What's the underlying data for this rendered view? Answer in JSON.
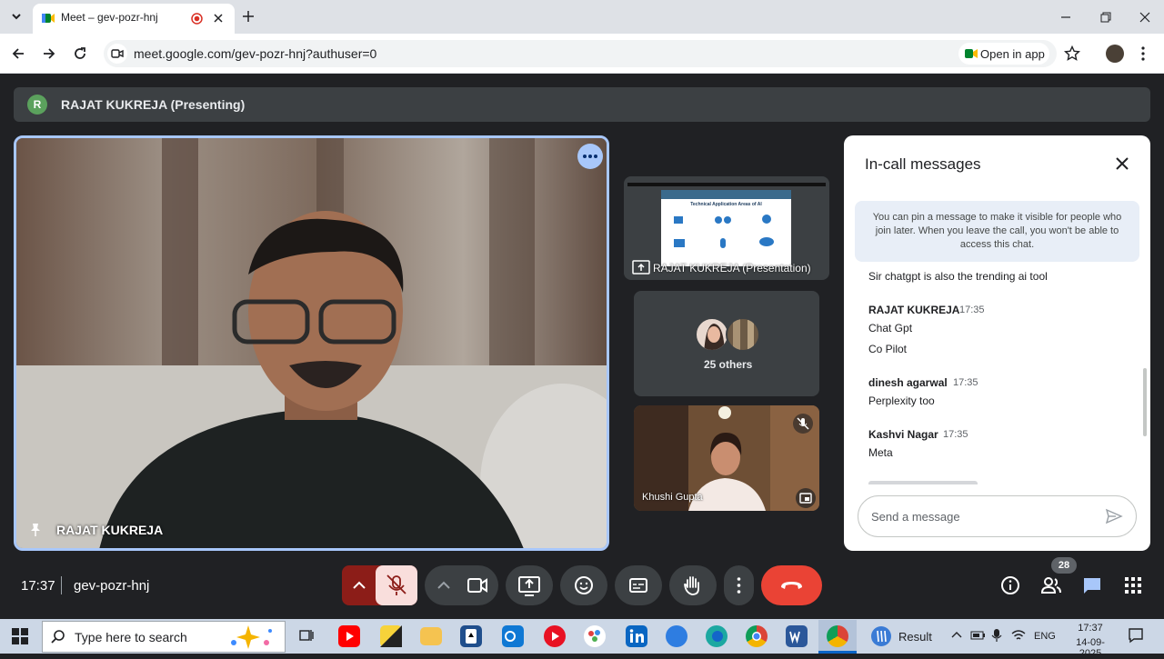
{
  "browser": {
    "tab_title": "Meet – gev-pozr-hnj",
    "url": "meet.google.com/gev-pozr-hnj?authuser=0",
    "open_in_app_label": "Open in app"
  },
  "meet": {
    "presenting_banner": {
      "avatar_letter": "R",
      "label": "RAJAT KUKREJA (Presenting)"
    },
    "main_tile": {
      "name": "RAJAT KUKREJA"
    },
    "side_tiles": {
      "screen_share_label": "RAJAT KUKREJA (Presentation)",
      "slide_title": "Technical Application Areas of AI",
      "others_label": "25 others",
      "participant_name": "Khushi Gupta"
    },
    "chat": {
      "title": "In-call messages",
      "info": "You can pin a message to make it visible for people who join later. When you leave the call, you won't be able to access this chat.",
      "messages_top": "Sir chatgpt is also the trending ai tool",
      "groups": [
        {
          "sender": "RAJAT KUKREJA",
          "time": "17:35",
          "lines": [
            "Chat Gpt",
            "Co Pilot"
          ]
        },
        {
          "sender": "dinesh agarwal",
          "time": "17:35",
          "lines": [
            "Perplexity too"
          ]
        },
        {
          "sender": "Kashvi Nagar",
          "time": "17:35",
          "lines": [
            "Meta"
          ]
        }
      ],
      "send_placeholder": "Send a message"
    },
    "bottom_bar": {
      "clock": "17:37",
      "meeting_code": "gev-pozr-hnj",
      "people_count": "28"
    }
  },
  "taskbar": {
    "search_placeholder": "Type here to search",
    "result_label": "Result",
    "language": "ENG",
    "time": "17:37",
    "date": "14-09-2025"
  },
  "colors": {
    "meet_bg": "#202124",
    "accent_blue": "#a8c7fa",
    "leave_red": "#ea4335",
    "mic_muted_bg": "#f9dedc"
  }
}
